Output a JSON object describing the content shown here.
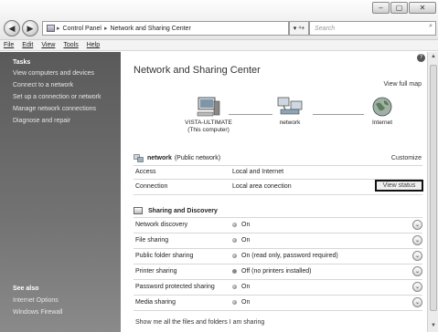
{
  "window": {
    "minimize": "–",
    "maximize": "▢",
    "close": "✕"
  },
  "address": {
    "back_icon": "◀",
    "forward_icon": "▶",
    "crumbs": [
      "Control Panel",
      "Network and Sharing Center"
    ],
    "sep": "▸",
    "dropdown": "▾",
    "refresh": "▾ ⁴+",
    "search_placeholder": "Search"
  },
  "menu": [
    "File",
    "Edit",
    "View",
    "Tools",
    "Help"
  ],
  "sidebar": {
    "tasks_title": "Tasks",
    "tasks": [
      "View computers and devices",
      "Connect to a network",
      "Set up a connection or network",
      "Manage network connections",
      "Diagnose and repair"
    ],
    "see_also_title": "See also",
    "see_also": [
      "Internet Options",
      "Windows Firewall"
    ]
  },
  "main": {
    "help_icon": "?",
    "title": "Network and Sharing Center",
    "view_full_map": "View full map",
    "map": {
      "computer_name": "VISTA-ULTIMATE",
      "computer_sub": "(This computer)",
      "network_label": "network",
      "internet_label": "Internet"
    },
    "network": {
      "name": "network",
      "type": "(Public network)",
      "customize": "Customize",
      "access_label": "Access",
      "access_value": "Local and Internet",
      "connection_label": "Connection",
      "connection_value": "Local area conection",
      "view_status": "View status"
    },
    "sharing": {
      "title": "Sharing and Discovery",
      "rows": [
        {
          "label": "Network discovery",
          "value": "On"
        },
        {
          "label": "File sharing",
          "value": "On"
        },
        {
          "label": "Public folder sharing",
          "value": "On (read only, password required)"
        },
        {
          "label": "Printer sharing",
          "value": "Off (no printers installed)"
        },
        {
          "label": "Password protected sharing",
          "value": "On"
        },
        {
          "label": "Media sharing",
          "value": "On"
        }
      ],
      "show_all": "Show me all the files and folders I am sharing"
    }
  }
}
